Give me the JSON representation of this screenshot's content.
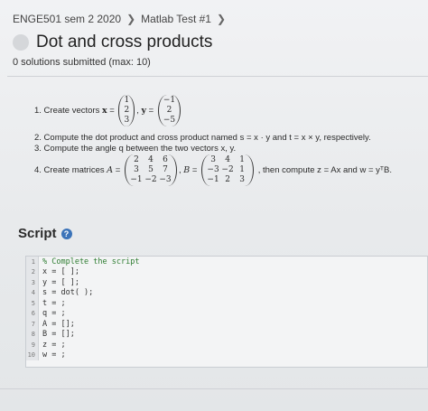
{
  "breadcrumb": {
    "course": "ENGE501 sem 2 2020",
    "assignment": "Matlab Test #1"
  },
  "title": "Dot and cross products",
  "subtitle": "0 solutions submitted (max: 10)",
  "problem": {
    "q1_label": "1. Create vectors",
    "x_vec": [
      "1",
      "2",
      "3"
    ],
    "y_vec": [
      "−1",
      "2",
      "−5"
    ],
    "q2_text": "2. Compute the dot product and cross product named s = x · y and t = x × y, respectively.",
    "q3_text": "3. Compute the angle q between the two vectors x, y.",
    "q4_label": "4. Create matrices",
    "A": [
      "2",
      "4",
      "6",
      "3",
      "5",
      "7",
      "−1",
      "−2",
      "−3"
    ],
    "B": [
      "3",
      "4",
      "1",
      "−3",
      "−2",
      "1",
      "−1",
      "2",
      "3"
    ],
    "q4_tail": ", then compute z = Ax and w = yᵀB."
  },
  "script": {
    "heading": "Script",
    "lines": [
      "% Complete the script",
      "x = [ ];",
      "y = [ ];",
      "s = dot( );",
      "t = ;",
      "q = ;",
      "A = [];",
      "B = [];",
      "z = ;",
      "w = ;"
    ],
    "line_numbers": [
      "1",
      "2",
      "3",
      "4",
      "5",
      "6",
      "7",
      "8",
      "9",
      "10"
    ]
  },
  "colors": {
    "help_icon": "#3b73b9",
    "comment": "#2f7d32"
  },
  "icons": {
    "breadcrumb_sep": "chevron-right-icon",
    "help": "question-circle-icon",
    "status": "status-circle-icon"
  }
}
